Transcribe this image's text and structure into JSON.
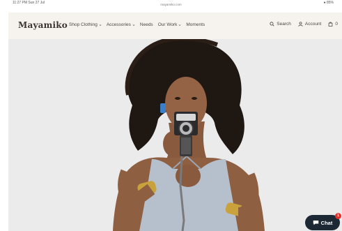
{
  "status_bar": {
    "time": "11:27 PM  Sun 27 Jul",
    "url": "mayamiko.com",
    "battery": "● 85%"
  },
  "header": {
    "logo": "Mayamiko",
    "nav": [
      {
        "label": "Shop Clothing",
        "has_dropdown": true
      },
      {
        "label": "Accessories",
        "has_dropdown": true
      },
      {
        "label": "Needs",
        "has_dropdown": false
      },
      {
        "label": "Our Work",
        "has_dropdown": true
      },
      {
        "label": "Moments",
        "has_dropdown": false
      }
    ],
    "search_label": "Search",
    "account_label": "Account",
    "cart_count": "0"
  },
  "chat": {
    "label": "Chat",
    "badge": "1"
  },
  "colors": {
    "header_bg": "#f6f3ee",
    "chat_bg": "#1c2833",
    "badge": "#e0312c"
  }
}
